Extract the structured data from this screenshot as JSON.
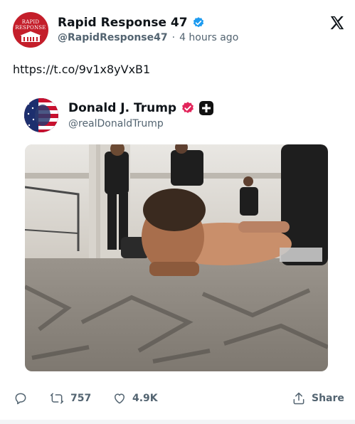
{
  "tweet": {
    "author": {
      "display_name": "Rapid Response 47",
      "handle": "@RapidResponse47",
      "avatar_text_line1": "RAPID",
      "avatar_text_line2": "RESPONSE",
      "avatar_color": "#c41e2a",
      "verified_color": "#1d9bf0"
    },
    "separator": "·",
    "time_ago": "4 hours ago",
    "text": "https://t.co/9v1x8yVxB1",
    "brand_icon": "x-logo-icon"
  },
  "quoted": {
    "display_name": "Donald J. Trump",
    "handle": "@realDonaldTrump",
    "badge_color": "#e2245a",
    "photo_description_icon": "photo"
  },
  "actions": {
    "reply_icon": "reply-icon",
    "retweet_count": "757",
    "like_count": "4.9K",
    "share_label": "Share"
  },
  "colors": {
    "text": "#0f1419",
    "secondary": "#536471"
  }
}
